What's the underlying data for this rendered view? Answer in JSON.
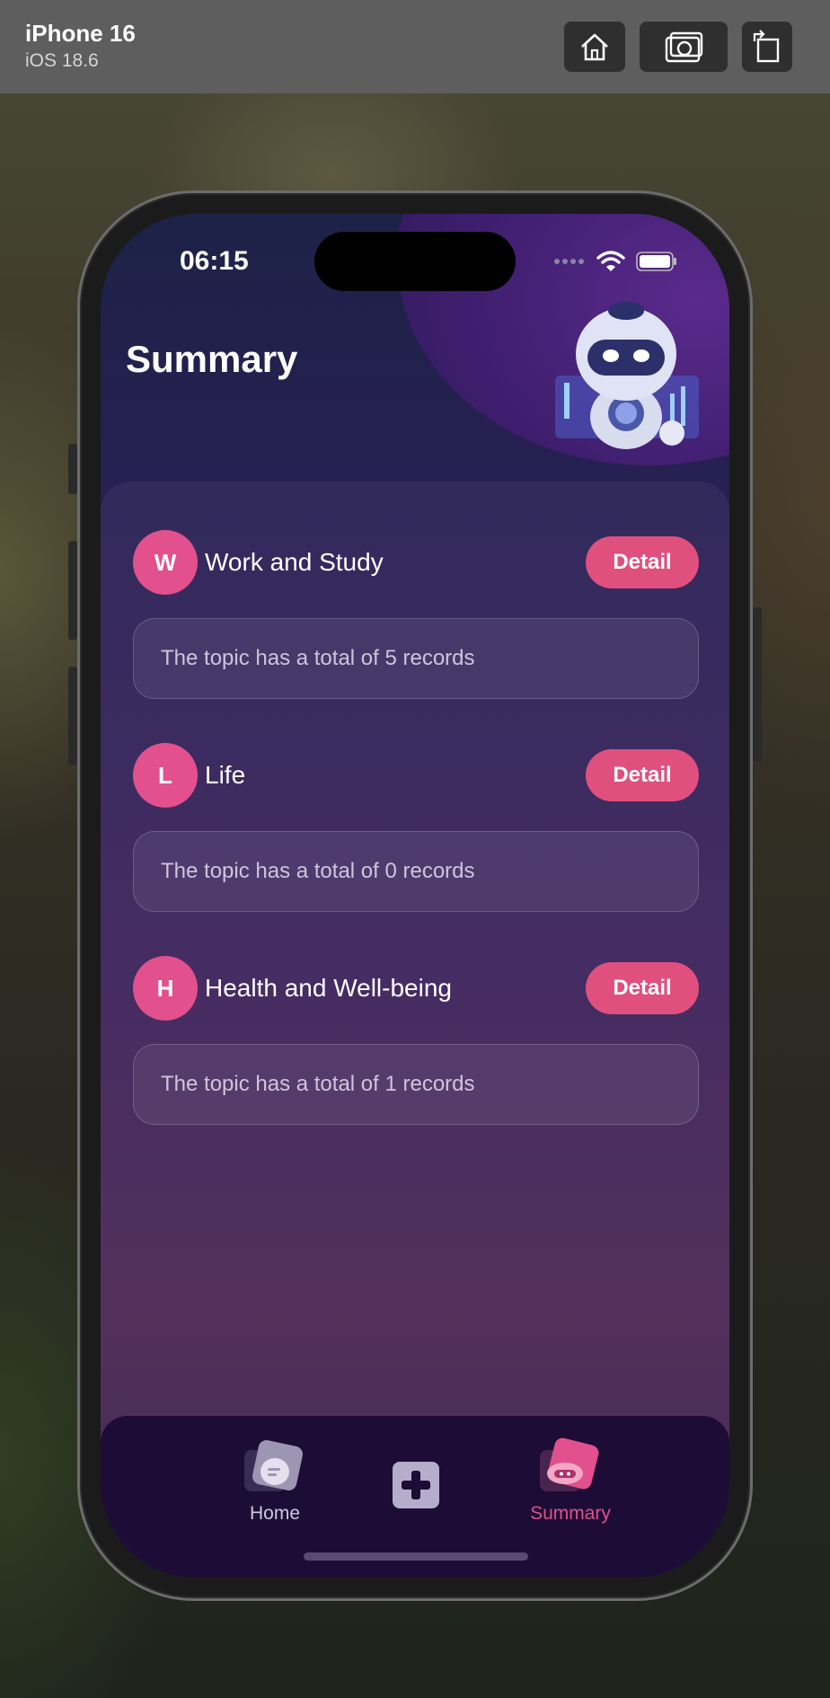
{
  "simulator": {
    "device": "iPhone 16",
    "os": "iOS 18.6",
    "buttons": [
      "home-icon",
      "screenshot-icon",
      "rotate-icon"
    ]
  },
  "status_bar": {
    "time": "06:15",
    "icons": [
      "signal-dots-icon",
      "wifi-icon",
      "battery-icon"
    ]
  },
  "header": {
    "title": "Summary"
  },
  "topics": [
    {
      "initial": "W",
      "name": "Work and Study",
      "detail_label": "Detail",
      "summary": "The topic has a total of 5 records"
    },
    {
      "initial": "L",
      "name": "Life",
      "detail_label": "Detail",
      "summary": "The topic has a total of 0 records"
    },
    {
      "initial": "H",
      "name": "Health and Well-being",
      "detail_label": "Detail",
      "summary": "The topic has a total of 1 records"
    }
  ],
  "tabbar": {
    "items": [
      {
        "label": "Home",
        "icon": "home-tab-icon",
        "active": false
      },
      {
        "label": "",
        "icon": "add-icon",
        "active": false
      },
      {
        "label": "Summary",
        "icon": "summary-tab-icon",
        "active": true
      }
    ]
  },
  "colors": {
    "accent": "#e0507f",
    "active_tab": "#e2508e",
    "inactive_tab": "#cfc8dc"
  }
}
